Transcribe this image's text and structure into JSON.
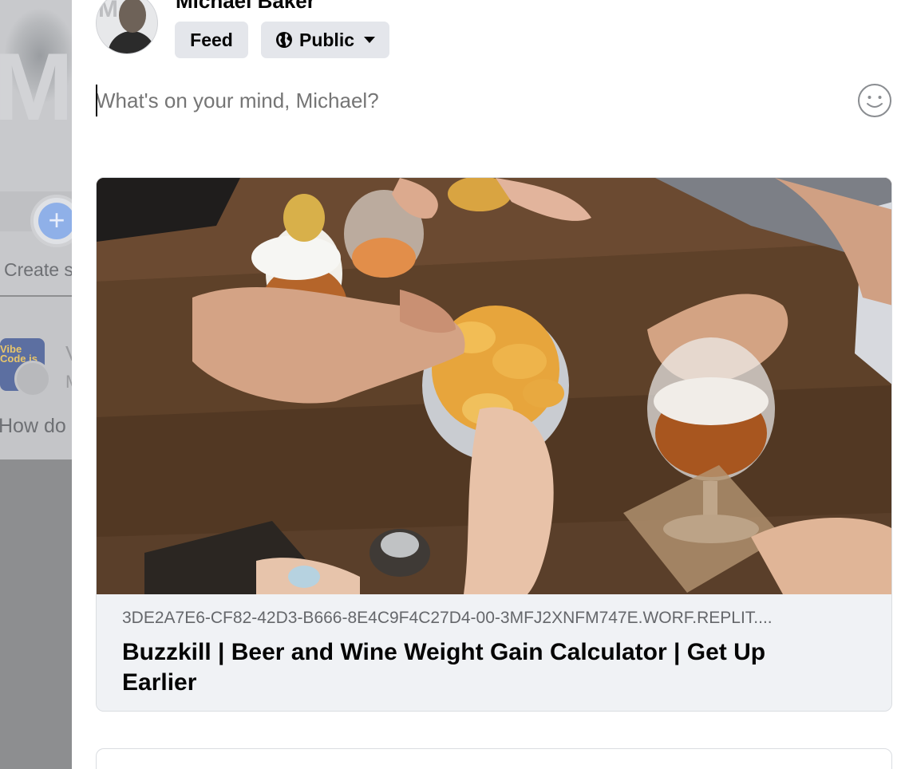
{
  "background": {
    "create_story_label": "Create s",
    "post_title_fragment": "V",
    "post_subtitle_fragment": "M",
    "post_text_fragment": "How do",
    "thumbnail_text": "Vibe Code is"
  },
  "composer": {
    "user_name": "Michael Baker",
    "feed_chip_label": "Feed",
    "audience_label": "Public",
    "audience_icon": "globe-icon",
    "placeholder": "What's on your mind, Michael?",
    "emoji_icon": "smiley-icon"
  },
  "link_preview": {
    "domain": "3DE2A7E6-CF82-42D3-B666-8E4C9F4C27D4-00-3MFJ2XNFM747E.WORF.REPLIT....",
    "title": "Buzzkill | Beer and Wine Weight Gain Calculator | Get Up Earlier"
  }
}
